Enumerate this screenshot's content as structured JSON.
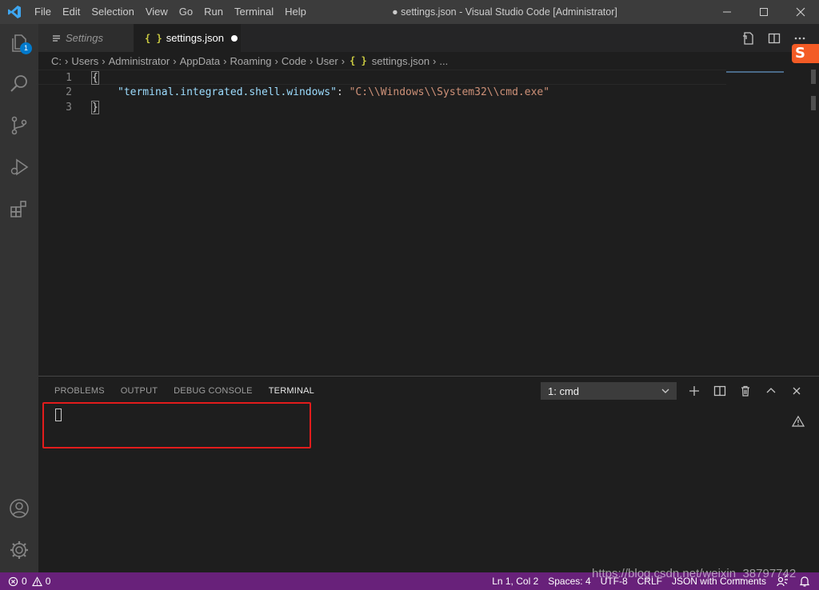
{
  "titlebar": {
    "menu": [
      "File",
      "Edit",
      "Selection",
      "View",
      "Go",
      "Run",
      "Terminal",
      "Help"
    ],
    "title": "● settings.json - Visual Studio Code [Administrator]"
  },
  "activitybar": {
    "explorer_badge": "1"
  },
  "tabs": [
    {
      "label": "Settings",
      "icon": "list-icon"
    },
    {
      "label": "settings.json",
      "icon": "json-braces-icon",
      "modified": true
    }
  ],
  "breadcrumb": {
    "items": [
      "C:",
      "Users",
      "Administrator",
      "AppData",
      "Roaming",
      "Code",
      "User"
    ],
    "file": "settings.json",
    "tail": "..."
  },
  "editor": {
    "lines": [
      {
        "num": "1",
        "open_brace": "{"
      },
      {
        "num": "2",
        "key": "\"terminal.integrated.shell.windows\"",
        "colon": ": ",
        "value": "\"C:\\\\Windows\\\\System32\\\\cmd.exe\""
      },
      {
        "num": "3",
        "close_brace": "}"
      }
    ],
    "json_brace_icon": "{ }"
  },
  "panel": {
    "tabs": [
      "PROBLEMS",
      "OUTPUT",
      "DEBUG CONSOLE",
      "TERMINAL"
    ],
    "active_tab": "TERMINAL",
    "terminal_select": "1: cmd"
  },
  "statusbar": {
    "errors": "0",
    "warnings": "0",
    "position": "Ln 1, Col 2",
    "spaces": "Spaces: 4",
    "encoding": "UTF-8",
    "eol": "CRLF",
    "language": "JSON with Comments"
  },
  "watermark": "https://blog.csdn.net/weixin_38797742",
  "colors": {
    "statusbar": "#68217a",
    "accent": "#007acc",
    "highlight_box": "#e21c1c"
  }
}
